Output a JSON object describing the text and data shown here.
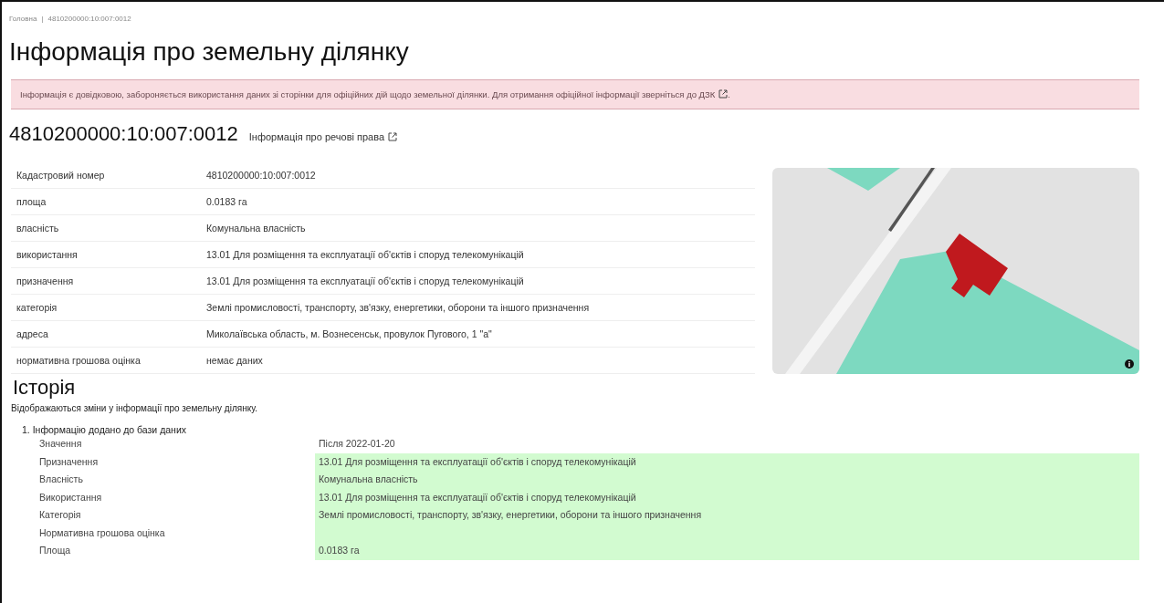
{
  "breadcrumb": {
    "home": "Головна",
    "separator": "|",
    "current": "4810200000:10:007:0012"
  },
  "title": "Інформація про земельну ділянку",
  "alert": {
    "text": "Інформація є довідковою, забороняється використання даних зі сторінки для офіційних дій щодо земельної ділянки. Для отримання офіційної інформації зверніться до",
    "link": "ДЗК",
    "end": "."
  },
  "parcel": {
    "number": "4810200000:10:007:0012",
    "rights_link": "Інформація про речові права"
  },
  "details": [
    {
      "label": "Кадастровий номер",
      "value": "4810200000:10:007:0012"
    },
    {
      "label": "площа",
      "value": "0.0183 га"
    },
    {
      "label": "власність",
      "value": "Комунальна власність"
    },
    {
      "label": "використання",
      "value": "13.01 Для розміщення та експлуатації об'єктів і споруд телекомунікацій"
    },
    {
      "label": "призначення",
      "value": "13.01 Для розміщення та експлуатації об'єктів і споруд телекомунікацій"
    },
    {
      "label": "категорія",
      "value": "Землі промисловості, транспорту, зв'язку, енергетики, оборони та іншого призначення"
    },
    {
      "label": "адреса",
      "value": "Миколаївська область, м. Вознесенськ, провулок Пугового, 1 \"а\""
    },
    {
      "label": "нормативна грошова оцінка",
      "value": "немає даних"
    }
  ],
  "history": {
    "title": "Історія",
    "subtitle": "Відображаються зміни у інформації про земельну ділянку.",
    "entries": [
      {
        "number": "1.",
        "title": "Інформацію додано до бази даних",
        "rows": [
          {
            "kind": "header",
            "label": "Значення",
            "value": "Після 2022-01-20"
          },
          {
            "kind": "change",
            "label": "Призначення",
            "value": "13.01 Для розміщення та експлуатації об'єктів і споруд телекомунікацій"
          },
          {
            "kind": "change",
            "label": "Власність",
            "value": "Комунальна власність"
          },
          {
            "kind": "change",
            "label": "Використання",
            "value": "13.01 Для розміщення та експлуатації об'єктів і споруд телекомунікацій"
          },
          {
            "kind": "change",
            "label": "Категорія",
            "value": "Землі промисловості, транспорту, зв'язку, енергетики, оборони та іншого призначення"
          },
          {
            "kind": "change",
            "label": "Нормативна грошова оцінка"
          },
          {
            "kind": "change",
            "label": "Площа",
            "value": "0.0183 га"
          }
        ]
      }
    ]
  }
}
